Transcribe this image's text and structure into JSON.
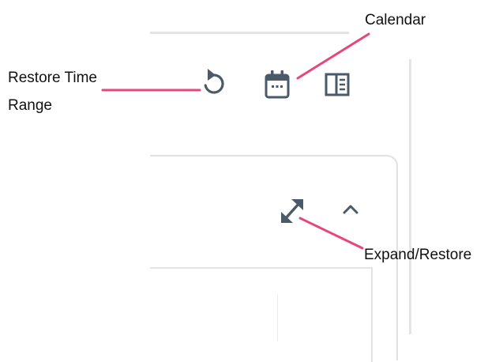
{
  "annotations": {
    "calendar": "Calendar",
    "restore_time_range_line1": "Restore Time",
    "restore_time_range_line2": "Range",
    "expand_restore": "Expand/Restore"
  },
  "icons": {
    "restore": "restore-time-range-icon",
    "calendar": "calendar-icon",
    "panel_toggle": "panel-toggle-icon",
    "expand": "expand-restore-icon",
    "collapse": "chevron-up-icon"
  },
  "colors": {
    "icon": "#4a5a6a",
    "annotation_line": "#e8457c",
    "text": "#111111"
  }
}
